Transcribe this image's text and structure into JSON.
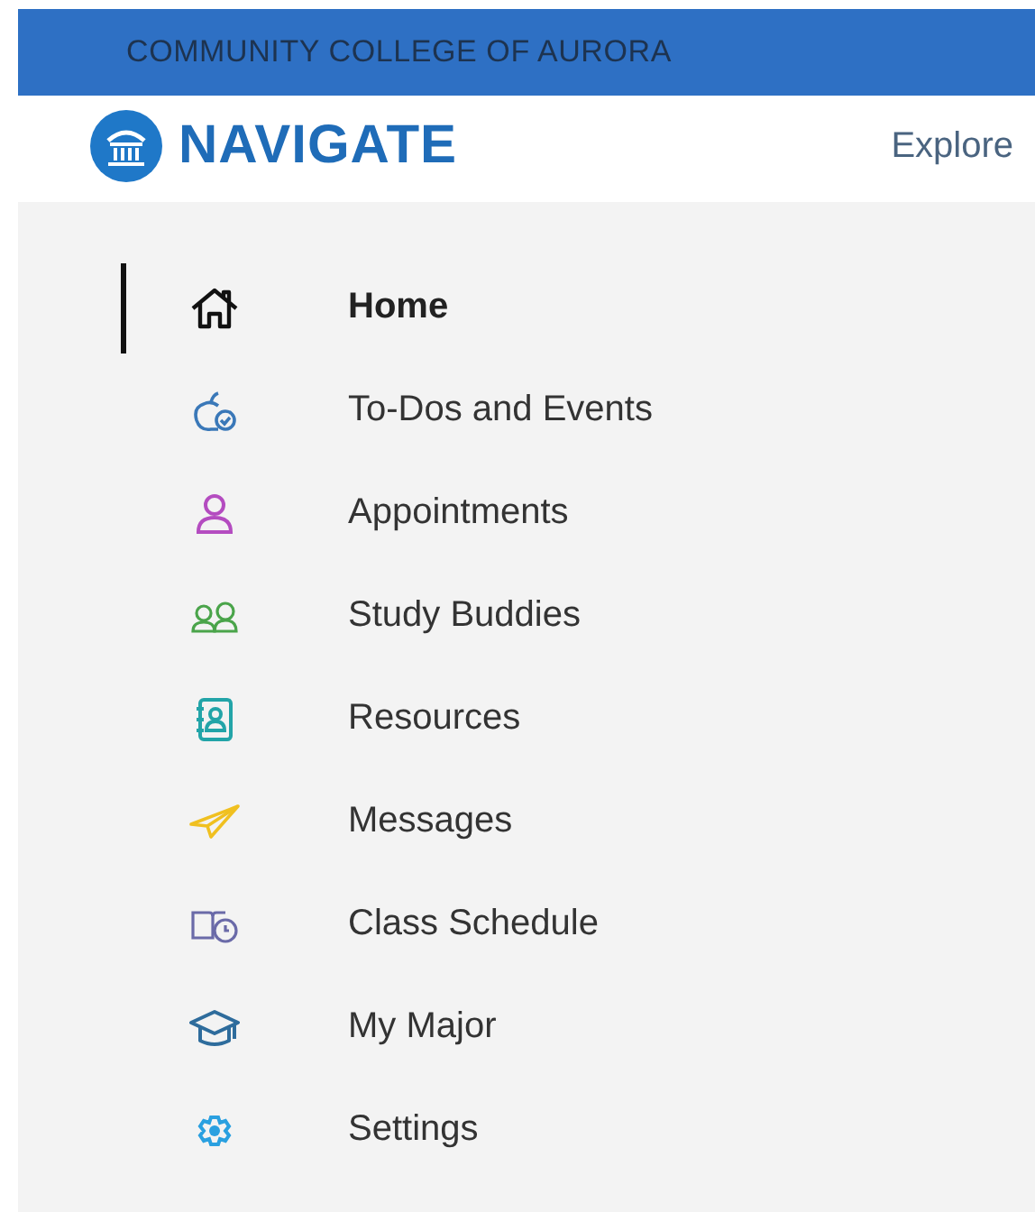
{
  "banner": {
    "title": "COMMUNITY COLLEGE OF AURORA"
  },
  "header": {
    "logo_text": "NAVIGATE",
    "link": "Explore"
  },
  "menu": [
    {
      "kind": "home",
      "label": "Home",
      "selected": true
    },
    {
      "kind": "todo",
      "label": "To-Dos and Events",
      "selected": false
    },
    {
      "kind": "person",
      "label": "Appointments",
      "selected": false
    },
    {
      "kind": "buddies",
      "label": "Study Buddies",
      "selected": false
    },
    {
      "kind": "contacts",
      "label": "Resources",
      "selected": false
    },
    {
      "kind": "plane",
      "label": "Messages",
      "selected": false
    },
    {
      "kind": "schedule",
      "label": "Class Schedule",
      "selected": false
    },
    {
      "kind": "cap",
      "label": "My Major",
      "selected": false
    },
    {
      "kind": "gear",
      "label": "Settings",
      "selected": false
    }
  ]
}
